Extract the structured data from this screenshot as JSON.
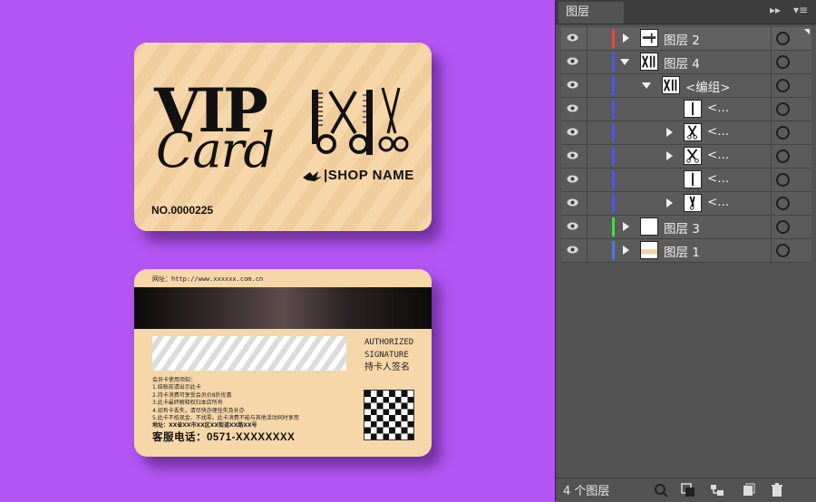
{
  "front_card": {
    "vip": "VIP",
    "card": "Card",
    "shop_name": "SHOP NAME",
    "card_number": "NO.0000225"
  },
  "back_card": {
    "website": "网址：http://www.xxxxxx.com.cn",
    "authorized_line1": "AUTHORIZED",
    "authorized_line2": "SIGNATURE",
    "holder_signature": "持卡人签名",
    "rules_title": "会员卡使用须知：",
    "rules": [
      "1.结账前请出示此卡",
      "2.持卡消费可享受会员价8折优惠",
      "3.此卡最终解释权归本店所有",
      "4.如有卡丢失，请尽快办理挂失及补办",
      "5.此卡不抵现金、不找零。此卡消费不能与其他活动同时享用"
    ],
    "address": "地址：XX省XX市XX区XX街道XX路XX号",
    "phone": "客服电话：0571-XXXXXXXX"
  },
  "panel": {
    "tab_title": "图层",
    "layer_count": "4 个图层",
    "rows": [
      {
        "name": "图层 2",
        "color": "#e04a4a",
        "indent": 0,
        "arrow": "right",
        "selected": true
      },
      {
        "name": "图层 4",
        "color": "#4f5bd8",
        "indent": 0,
        "arrow": "down",
        "selected": false
      },
      {
        "name": "<编组>",
        "color": "#4f5bd8",
        "indent": 1,
        "arrow": "down",
        "selected": false
      },
      {
        "name": "<...",
        "color": "#4f5bd8",
        "indent": 2,
        "arrow": "none",
        "selected": false
      },
      {
        "name": "<...",
        "color": "#4f5bd8",
        "indent": 2,
        "arrow": "right",
        "selected": false
      },
      {
        "name": "<...",
        "color": "#4f5bd8",
        "indent": 2,
        "arrow": "right",
        "selected": false
      },
      {
        "name": "<...",
        "color": "#4f5bd8",
        "indent": 2,
        "arrow": "none",
        "selected": false
      },
      {
        "name": "<...",
        "color": "#4f5bd8",
        "indent": 2,
        "arrow": "right",
        "selected": false
      },
      {
        "name": "图层 3",
        "color": "#4bd84b",
        "indent": 0,
        "arrow": "right",
        "selected": false
      },
      {
        "name": "图层 1",
        "color": "#4f7bd8",
        "indent": 0,
        "arrow": "right",
        "selected": false
      }
    ]
  },
  "colors": {
    "background": "#b455f5",
    "card": "#f6d7a9",
    "panel": "#535353"
  }
}
